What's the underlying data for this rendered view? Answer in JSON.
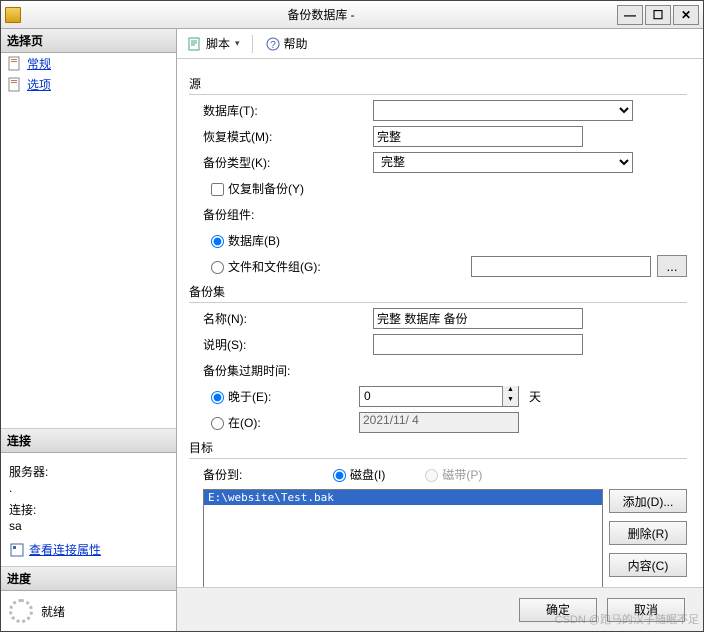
{
  "titlebar": {
    "title": "备份数据库 - "
  },
  "win_buttons": {
    "min": "—",
    "max": "☐",
    "close": "✕"
  },
  "sidebar": {
    "select_header": "选择页",
    "items": [
      {
        "label": "常规"
      },
      {
        "label": "选项"
      }
    ],
    "conn_header": "连接",
    "server_label": "服务器:",
    "server_value": ".",
    "conn_label": "连接:",
    "conn_value": "sa",
    "view_props": "查看连接属性",
    "progress_header": "进度",
    "progress_status": "就绪"
  },
  "toolbar": {
    "script": "脚本",
    "help": "帮助"
  },
  "source": {
    "title": "源",
    "db_label": "数据库(T):",
    "db_value": "",
    "recovery_label": "恢复模式(M):",
    "recovery_value": "完整",
    "type_label": "备份类型(K):",
    "type_value": "完整",
    "copy_only": "仅复制备份(Y)",
    "component_label": "备份组件:",
    "radio_db": "数据库(B)",
    "radio_fg": "文件和文件组(G):"
  },
  "set": {
    "title": "备份集",
    "name_label": "名称(N):",
    "name_value": "完整 数据库 备份",
    "desc_label": "说明(S):",
    "desc_value": "",
    "expire_label": "备份集过期时间:",
    "after_label": "晚于(E):",
    "after_value": "0",
    "after_unit": "天",
    "on_label": "在(O):",
    "on_value": "2021/11/ 4"
  },
  "dest": {
    "title": "目标",
    "to_label": "备份到:",
    "disk": "磁盘(I)",
    "tape": "磁带(P)",
    "path": "E:\\website\\Test.bak",
    "add": "添加(D)...",
    "remove": "删除(R)",
    "contents": "内容(C)"
  },
  "footer": {
    "ok": "确定",
    "cancel": "取消"
  },
  "watermark": "CSDN @跑马的汉子随眠不足"
}
